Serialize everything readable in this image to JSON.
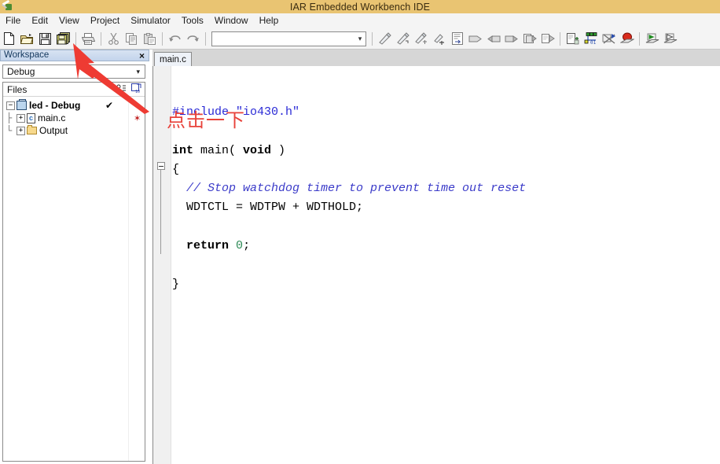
{
  "window": {
    "title": "IAR Embedded Workbench IDE",
    "app_icon": "iar-logo-icon"
  },
  "menubar": {
    "items": [
      {
        "label": "File"
      },
      {
        "label": "Edit"
      },
      {
        "label": "View"
      },
      {
        "label": "Project"
      },
      {
        "label": "Simulator"
      },
      {
        "label": "Tools"
      },
      {
        "label": "Window"
      },
      {
        "label": "Help"
      }
    ]
  },
  "toolbar": {
    "combo_value": "",
    "groups": [
      [
        "new-file-icon",
        "open-file-icon",
        "save-icon",
        "save-all-icon"
      ],
      [
        "print-icon"
      ],
      [
        "cut-icon",
        "copy-icon",
        "paste-icon"
      ],
      [
        "undo-icon",
        "redo-icon"
      ],
      [
        "combo"
      ],
      [
        "find-icon",
        "find-next-icon",
        "find-previous-icon",
        "replace-icon",
        "goto-icon"
      ],
      [
        "bookmark-toggle-icon",
        "bookmark-previous-icon",
        "bookmark-next-icon",
        "navigate-backward-icon",
        "navigate-forward-icon"
      ],
      [
        "compile-icon",
        "make-icon",
        "stop-build-icon",
        "debug-icon"
      ],
      [
        "run-icon",
        "run-to-cursor-icon"
      ]
    ]
  },
  "workspace": {
    "panel_title": "Workspace",
    "close_label": "×",
    "config_value": "Debug",
    "config_arrow": "⌄",
    "files_column_header": "Files",
    "header_icons": [
      "workspace-overview-icon",
      "workspace-filter-icon"
    ],
    "tree": [
      {
        "label": "led - Debug",
        "expander": "−",
        "icon": "project-icon",
        "bold": true,
        "indent": 0,
        "check": "✔",
        "star": ""
      },
      {
        "label": "main.c",
        "expander": "+",
        "icon": "c-file-icon",
        "bold": false,
        "indent": 1,
        "check": "",
        "star": "✶"
      },
      {
        "label": "Output",
        "expander": "+",
        "icon": "folder-icon",
        "bold": false,
        "indent": 1,
        "check": "",
        "star": ""
      }
    ]
  },
  "editor": {
    "tabs": [
      {
        "label": "main.c",
        "active": true
      }
    ],
    "fold_marker": "−",
    "code_lines": [
      [
        {
          "t": "#include ",
          "c": "k-include"
        },
        {
          "t": "\"io430.h\"",
          "c": "k-str"
        }
      ],
      [],
      [
        {
          "t": "int",
          "c": "k-kw"
        },
        {
          "t": " main( ",
          "c": "k-plain"
        },
        {
          "t": "void",
          "c": "k-kw"
        },
        {
          "t": " )",
          "c": "k-plain"
        }
      ],
      [
        {
          "t": "{",
          "c": "k-plain"
        }
      ],
      [
        {
          "t": "  // Stop watchdog timer to prevent time out reset",
          "c": "k-com"
        }
      ],
      [
        {
          "t": "  WDTCTL = WDTPW + WDTHOLD;",
          "c": "k-plain"
        }
      ],
      [],
      [
        {
          "t": "  ",
          "c": "k-plain"
        },
        {
          "t": "return",
          "c": "k-kw"
        },
        {
          "t": " ",
          "c": "k-plain"
        },
        {
          "t": "0",
          "c": "k-num"
        },
        {
          "t": ";",
          "c": "k-plain"
        }
      ],
      [],
      [
        {
          "t": "}",
          "c": "k-plain"
        }
      ]
    ]
  },
  "annotations": {
    "callout_text": "点击一下",
    "arrow_color": "#ee3b33",
    "arrow_target": "save-all-toolbar-button"
  },
  "colors": {
    "titlebar_bg": "#e9c472",
    "menubar_bg": "#f4f4f4",
    "toolbar_bg": "#f4f4f4",
    "panel_header_bg": "#c8d8ee",
    "annotation_red": "#e8423a",
    "comment_blue": "#3b3bc9",
    "string_blue": "#2a2ad6",
    "number_green": "#2e8b57"
  }
}
